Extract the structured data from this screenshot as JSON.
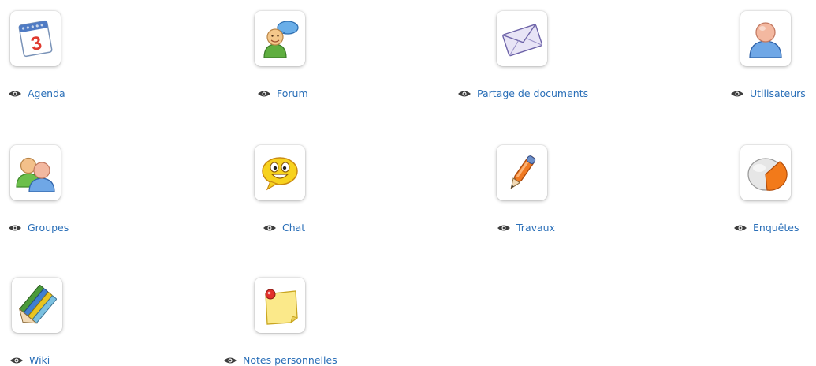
{
  "tools": [
    {
      "key": "agenda",
      "label": "Agenda",
      "icon": "calendar-icon",
      "calendar_day": "3"
    },
    {
      "key": "forum",
      "label": "Forum",
      "icon": "forum-icon"
    },
    {
      "key": "documents",
      "label": "Partage de documents",
      "icon": "envelope-icon"
    },
    {
      "key": "users",
      "label": "Utilisateurs",
      "icon": "user-icon"
    },
    {
      "key": "groups",
      "label": "Groupes",
      "icon": "group-icon"
    },
    {
      "key": "chat",
      "label": "Chat",
      "icon": "chat-smiley-icon"
    },
    {
      "key": "works",
      "label": "Travaux",
      "icon": "pen-icon"
    },
    {
      "key": "surveys",
      "label": "Enquêtes",
      "icon": "pie-chart-icon"
    },
    {
      "key": "wiki",
      "label": "Wiki",
      "icon": "pencils-icon"
    },
    {
      "key": "notes",
      "label": "Notes personnelles",
      "icon": "sticky-note-icon"
    }
  ],
  "colors": {
    "link": "#2a6fb8",
    "eye": "#3d3d3d"
  }
}
